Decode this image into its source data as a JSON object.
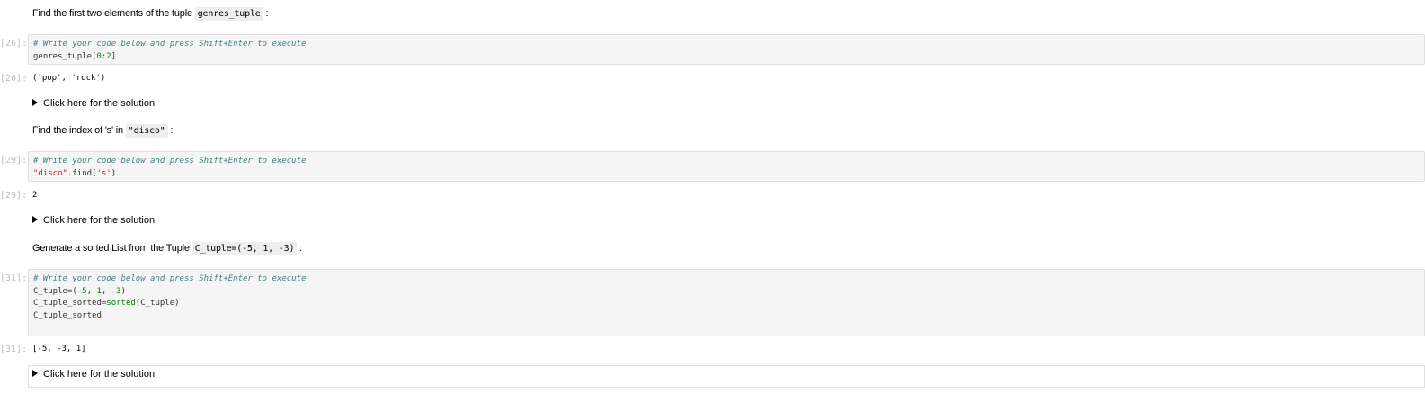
{
  "cells": [
    {
      "prompt_text": "Find the first two elements of the tuple",
      "prompt_code": "genres_tuple",
      "prompt_suffix": ":",
      "in_label": "[26]:",
      "comment": "# Write your code below and press Shift+Enter to execute",
      "code_a": "genres_tuple[",
      "code_b": "0",
      "code_c": ":",
      "code_d": "2",
      "code_e": "]",
      "out_label": "[26]:",
      "output": "('pop', 'rock')",
      "solution_label": "Click here for the solution"
    },
    {
      "prompt_text": "Find the index of 's' in",
      "prompt_code": "\"disco\"",
      "prompt_suffix": ":",
      "in_label": "[29]:",
      "comment": "# Write your code below and press Shift+Enter to execute",
      "code_a": "\"disco\"",
      "code_b": ".find(",
      "code_c": "'s'",
      "code_d": ")",
      "out_label": "[29]:",
      "output": "2",
      "solution_label": "Click here for the solution"
    },
    {
      "prompt_text": "Generate a sorted List from the Tuple",
      "prompt_code": "C_tuple=(-5, 1, -3)",
      "prompt_suffix": ":",
      "in_label": "[31]:",
      "comment": "# Write your code below and press Shift+Enter to execute",
      "line1_a": "C_tuple=(",
      "line1_b": "-5",
      "line1_c": ", ",
      "line1_d": "1",
      "line1_e": ", ",
      "line1_f": "-3",
      "line1_g": ")",
      "line2_a": "C_tuple_sorted=",
      "line2_b": "sorted",
      "line2_c": "(C_tuple)",
      "line3": "C_tuple_sorted",
      "out_label": "[31]:",
      "output": "[-5, -3, 1]",
      "solution_label": "Click here for the solution"
    }
  ]
}
